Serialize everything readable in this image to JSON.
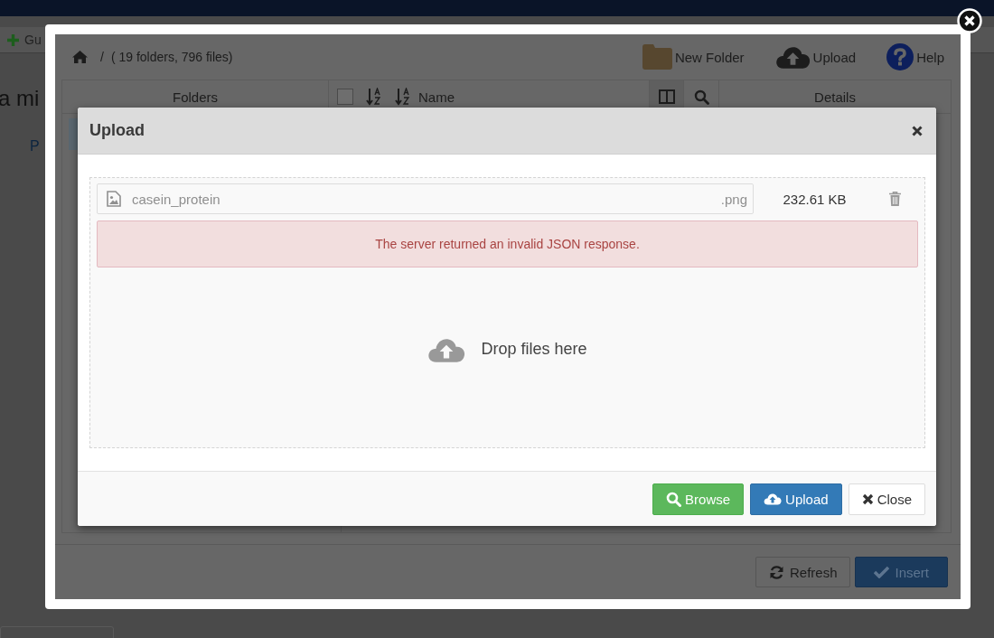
{
  "background_page": {
    "toolbar_button": "Gu",
    "heading": "a mi",
    "label": "P"
  },
  "file_manager": {
    "breadcrumb": "/",
    "summary": "( 19 folders, 796 files)",
    "toolbar": [
      {
        "kind": "folder",
        "label": "New Folder"
      },
      {
        "kind": "upload",
        "label": "Upload"
      },
      {
        "kind": "help",
        "label": "Help"
      }
    ],
    "columns": {
      "folders": "Folders",
      "name": "Name",
      "details": "Details"
    },
    "select_all": {
      "checked": false
    },
    "footer_buttons": [
      {
        "kind": "refresh",
        "label": "Refresh"
      },
      {
        "kind": "insert",
        "label": "Insert"
      }
    ]
  },
  "upload_dialog": {
    "title": "Upload",
    "files": [
      {
        "name": "casein_protein",
        "extension": ".png",
        "size": "232.61 KB",
        "error": "The server returned an invalid JSON response."
      }
    ],
    "drop_hint": "Drop files here",
    "buttons": [
      {
        "kind": "browse",
        "label": "Browse"
      },
      {
        "kind": "upload",
        "label": "Upload"
      },
      {
        "kind": "close",
        "label": "Close"
      }
    ]
  }
}
